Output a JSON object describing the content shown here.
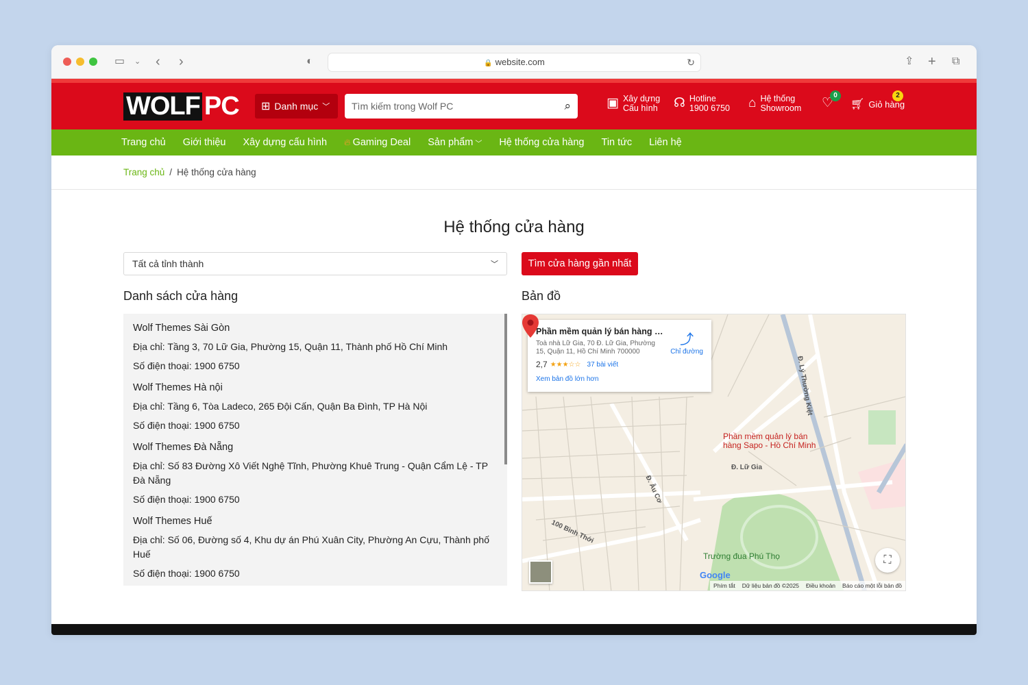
{
  "browser": {
    "url": "website.com"
  },
  "header": {
    "logo_wolf": "WOLF",
    "logo_pc": "PC",
    "category_label": "Danh mục",
    "search_placeholder": "Tìm kiếm trong Wolf PC",
    "build_line1": "Xây dựng",
    "build_line2": "Cấu hình",
    "hotline_line1": "Hotline",
    "hotline_line2": "1900 6750",
    "showroom_line1": "Hệ thống",
    "showroom_line2": "Showroom",
    "wishlist_count": "0",
    "cart_label": "Giỏ hàng",
    "cart_count": "2"
  },
  "nav": {
    "items": [
      "Trang chủ",
      "Giới thiệu",
      "Xây dựng cấu hình",
      "Gaming Deal",
      "Sản phẩm",
      "Hệ thống cửa hàng",
      "Tin tức",
      "Liên hệ"
    ]
  },
  "breadcrumb": {
    "home": "Trang chủ",
    "separator": "/",
    "current": "Hệ thống cửa hàng"
  },
  "page": {
    "title": "Hệ thống cửa hàng",
    "province_select": "Tất cả tỉnh thành",
    "find_button": "Tìm cửa hàng gần nhất",
    "list_title": "Danh sách cửa hàng",
    "map_title": "Bản đồ"
  },
  "stores": [
    {
      "name": "Wolf Themes Sài Gòn",
      "address_label": "Địa chỉ:",
      "address": "Tầng 3, 70 Lữ Gia, Phường 15, Quận 11, Thành phố Hồ Chí Minh",
      "phone_label": "Số điện thoại:",
      "phone": "1900 6750"
    },
    {
      "name": "Wolf Themes Hà nội",
      "address_label": "Địa chỉ:",
      "address": "Tầng 6, Tòa Ladeco, 265 Đội Cấn, Quận Ba Đình, TP Hà Nội",
      "phone_label": "Số điện thoại:",
      "phone": "1900 6750"
    },
    {
      "name": "Wolf Themes Đà Nẵng",
      "address_label": "Địa chỉ:",
      "address": "Số 83 Đường Xô Viết Nghệ Tĩnh, Phường Khuê Trung - Quận Cẩm Lệ - TP Đà Nẵng",
      "phone_label": "Số điện thoại:",
      "phone": "1900 6750"
    },
    {
      "name": "Wolf Themes Huế",
      "address_label": "Địa chỉ:",
      "address": "Số 06, Đường số 4, Khu dự án Phú Xuân City, Phường An Cựu, Thành phố Huế",
      "phone_label": "Số điện thoại:",
      "phone": "1900 6750"
    }
  ],
  "map": {
    "card_title": "Phần mềm quản lý bán hàng S...",
    "card_address": "Toà nhà Lữ Gia, 70 Đ. Lữ Gia, Phường 15, Quận 11, Hồ Chí Minh 700000",
    "rating": "2,7",
    "stars": "★★★☆☆",
    "reviews": "37 bài viết",
    "bigger_map": "Xem bản đồ lớn hơn",
    "directions": "Chỉ đường",
    "pin_label_1": "Phần mềm quản lý bán",
    "pin_label_2": "hàng Sapo - Hồ Chí Minh",
    "place_race": "Trường đua Phú Thọ",
    "street_lugia": "Đ. Lữ Gia",
    "street_ly": "Đ. Lý Thường Kiệt",
    "street_binhthoi": "100 Bình Thới",
    "street_auco": "Đ. Âu Cơ",
    "google": "Google",
    "footer_shortcuts": "Phím tắt",
    "footer_data": "Dữ liệu bản đồ ©2025",
    "footer_terms": "Điều khoản",
    "footer_report": "Báo cáo một lỗi bản đồ"
  },
  "colors": {
    "brand_red": "#db0a1b",
    "nav_green": "#6ab614"
  }
}
